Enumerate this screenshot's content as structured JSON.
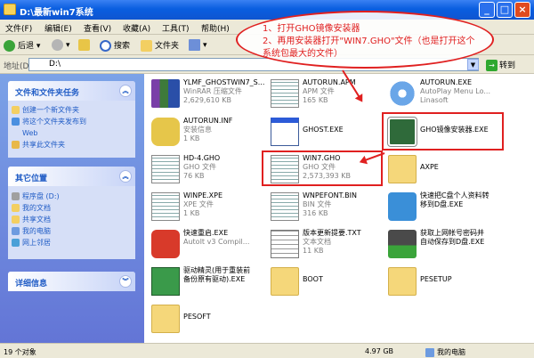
{
  "window": {
    "title": "D:\\最新win7系统"
  },
  "menu": [
    "文件(F)",
    "编辑(E)",
    "查看(V)",
    "收藏(A)",
    "工具(T)",
    "帮助(H)"
  ],
  "toolbar": {
    "back": "后退",
    "search": "搜索",
    "folders": "文件夹"
  },
  "address": {
    "label": "地址(D)",
    "value": "D:\\",
    "go": "转到"
  },
  "annotation": {
    "line1": "1、打开GHO镜像安装器",
    "line2": "2、再用安装器打开\"WIN7.GHO\"文件（也是打开这个系统包最大的文件）"
  },
  "tasks": {
    "title": "文件和文件夹任务",
    "items": [
      "创建一个新文件夹",
      "将这个文件夹发布到",
      "Web",
      "共享此文件夹"
    ]
  },
  "places": {
    "title": "其它位置",
    "items": [
      "程序盘 (D:)",
      "我的文档",
      "共享文档",
      "我的电脑",
      "网上邻居"
    ]
  },
  "details": {
    "title": "详细信息"
  },
  "files": [
    {
      "name": "YLMF_GHOSTWIN7_S...",
      "type": "WinRAR 压缩文件",
      "size": "2,629,610 KB"
    },
    {
      "name": "AUTORUN.APM",
      "type": "APM 文件",
      "size": "165 KB"
    },
    {
      "name": "AUTORUN.EXE",
      "type": "AutoPlay Menu Lo...",
      "size": "Linasoft"
    },
    {
      "name": "AUTORUN.INF",
      "type": "安装信息",
      "size": "1 KB"
    },
    {
      "name": "GHOST.EXE",
      "type": "",
      "size": ""
    },
    {
      "name": "GHO镜像安装器.EXE",
      "type": "",
      "size": ""
    },
    {
      "name": "HD-4.GHO",
      "type": "GHO 文件",
      "size": "76 KB"
    },
    {
      "name": "WIN7.GHO",
      "type": "GHO 文件",
      "size": "2,573,393 KB"
    },
    {
      "name": "AXPE",
      "type": "",
      "size": ""
    },
    {
      "name": "WINPE.XPE",
      "type": "XPE 文件",
      "size": "1 KB"
    },
    {
      "name": "WNPEFONT.BIN",
      "type": "BIN 文件",
      "size": "316 KB"
    },
    {
      "name": "快速把C盘个人资料转",
      "type": "移到D盘.EXE",
      "size": ""
    },
    {
      "name": "快速重启.EXE",
      "type": "AutoIt v3 Compil...",
      "size": ""
    },
    {
      "name": "版本更新提要.TXT",
      "type": "文本文档",
      "size": "11 KB"
    },
    {
      "name": "获取上网帐号密码并",
      "type": "自动保存到D盘.EXE",
      "size": ""
    },
    {
      "name": "驱动精灵(用于重装前",
      "type": "备份原有驱动).EXE",
      "size": ""
    },
    {
      "name": "BOOT",
      "type": "",
      "size": ""
    },
    {
      "name": "PESETUP",
      "type": "",
      "size": ""
    },
    {
      "name": "PESOFT",
      "type": "",
      "size": ""
    }
  ],
  "status": {
    "count": "19 个对象",
    "size": "4.97 GB",
    "location": "我的电脑"
  }
}
